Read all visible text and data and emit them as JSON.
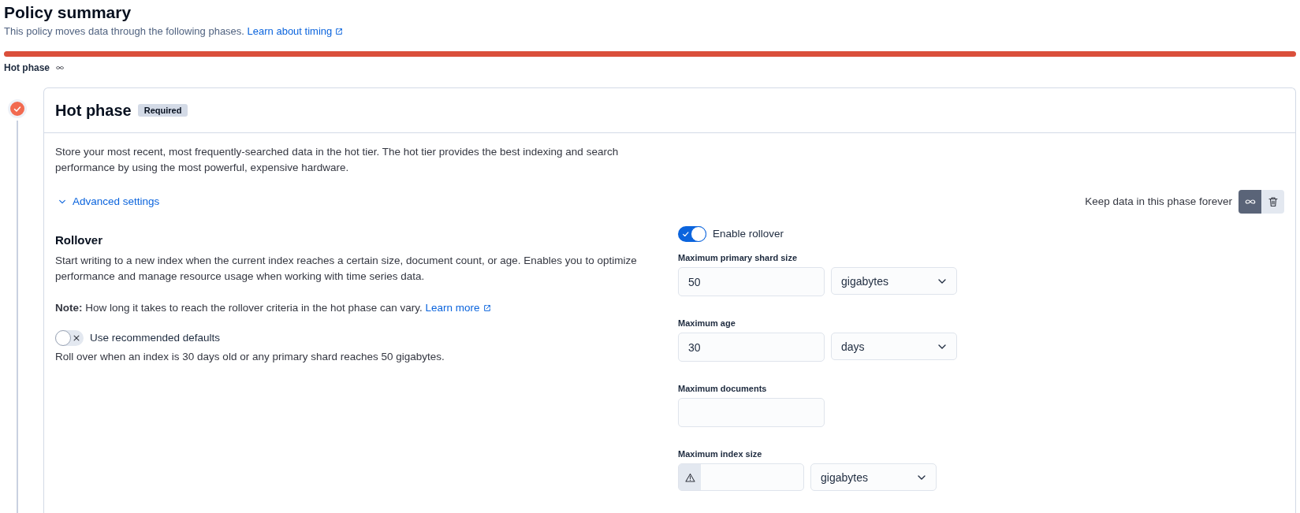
{
  "summary": {
    "title": "Policy summary",
    "description": "This policy moves data through the following phases.",
    "link": "Learn about timing"
  },
  "timeline": [
    {
      "label": "Hot phase",
      "forever": true
    }
  ],
  "phase": {
    "title": "Hot phase",
    "badge": "Required",
    "completed": true,
    "description": "Store your most recent, most frequently-searched data in the hot tier. The hot tier provides the best indexing and search performance by using the most powerful, expensive hardware.",
    "advanced_settings": {
      "label": "Advanced settings",
      "expanded": true
    },
    "keep_data": {
      "label": "Keep data in this phase forever",
      "buttons": [
        {
          "kind": "forever",
          "selected": true
        },
        {
          "kind": "delete",
          "selected": false
        }
      ]
    },
    "rollover": {
      "title": "Rollover",
      "description": "Start writing to a new index when the current index reaches a certain size, document count, or age. Enables you to optimize performance and manage resource usage when working with time series data.",
      "note": "**Note:** How long it takes to reach the rollover criteria in the hot phase can vary.",
      "note_link": "Learn more",
      "recommended": {
        "label": "Use recommended defaults",
        "on": false
      },
      "recommended_summary": "Roll over when an index is 30 days old or any primary shard reaches 50 gigabytes.",
      "enable": {
        "label": "Enable rollover",
        "on": true
      },
      "fields": [
        {
          "kind": "number",
          "label": "Maximum primary shard size",
          "value": "50",
          "unit": "gigabytes"
        },
        {
          "kind": "number",
          "label": "Maximum age",
          "value": "30",
          "unit": "days"
        },
        {
          "kind": "number",
          "label": "Maximum documents"
        },
        {
          "kind": "warning",
          "label": "Maximum index size",
          "unit": "gigabytes"
        }
      ]
    }
  }
}
